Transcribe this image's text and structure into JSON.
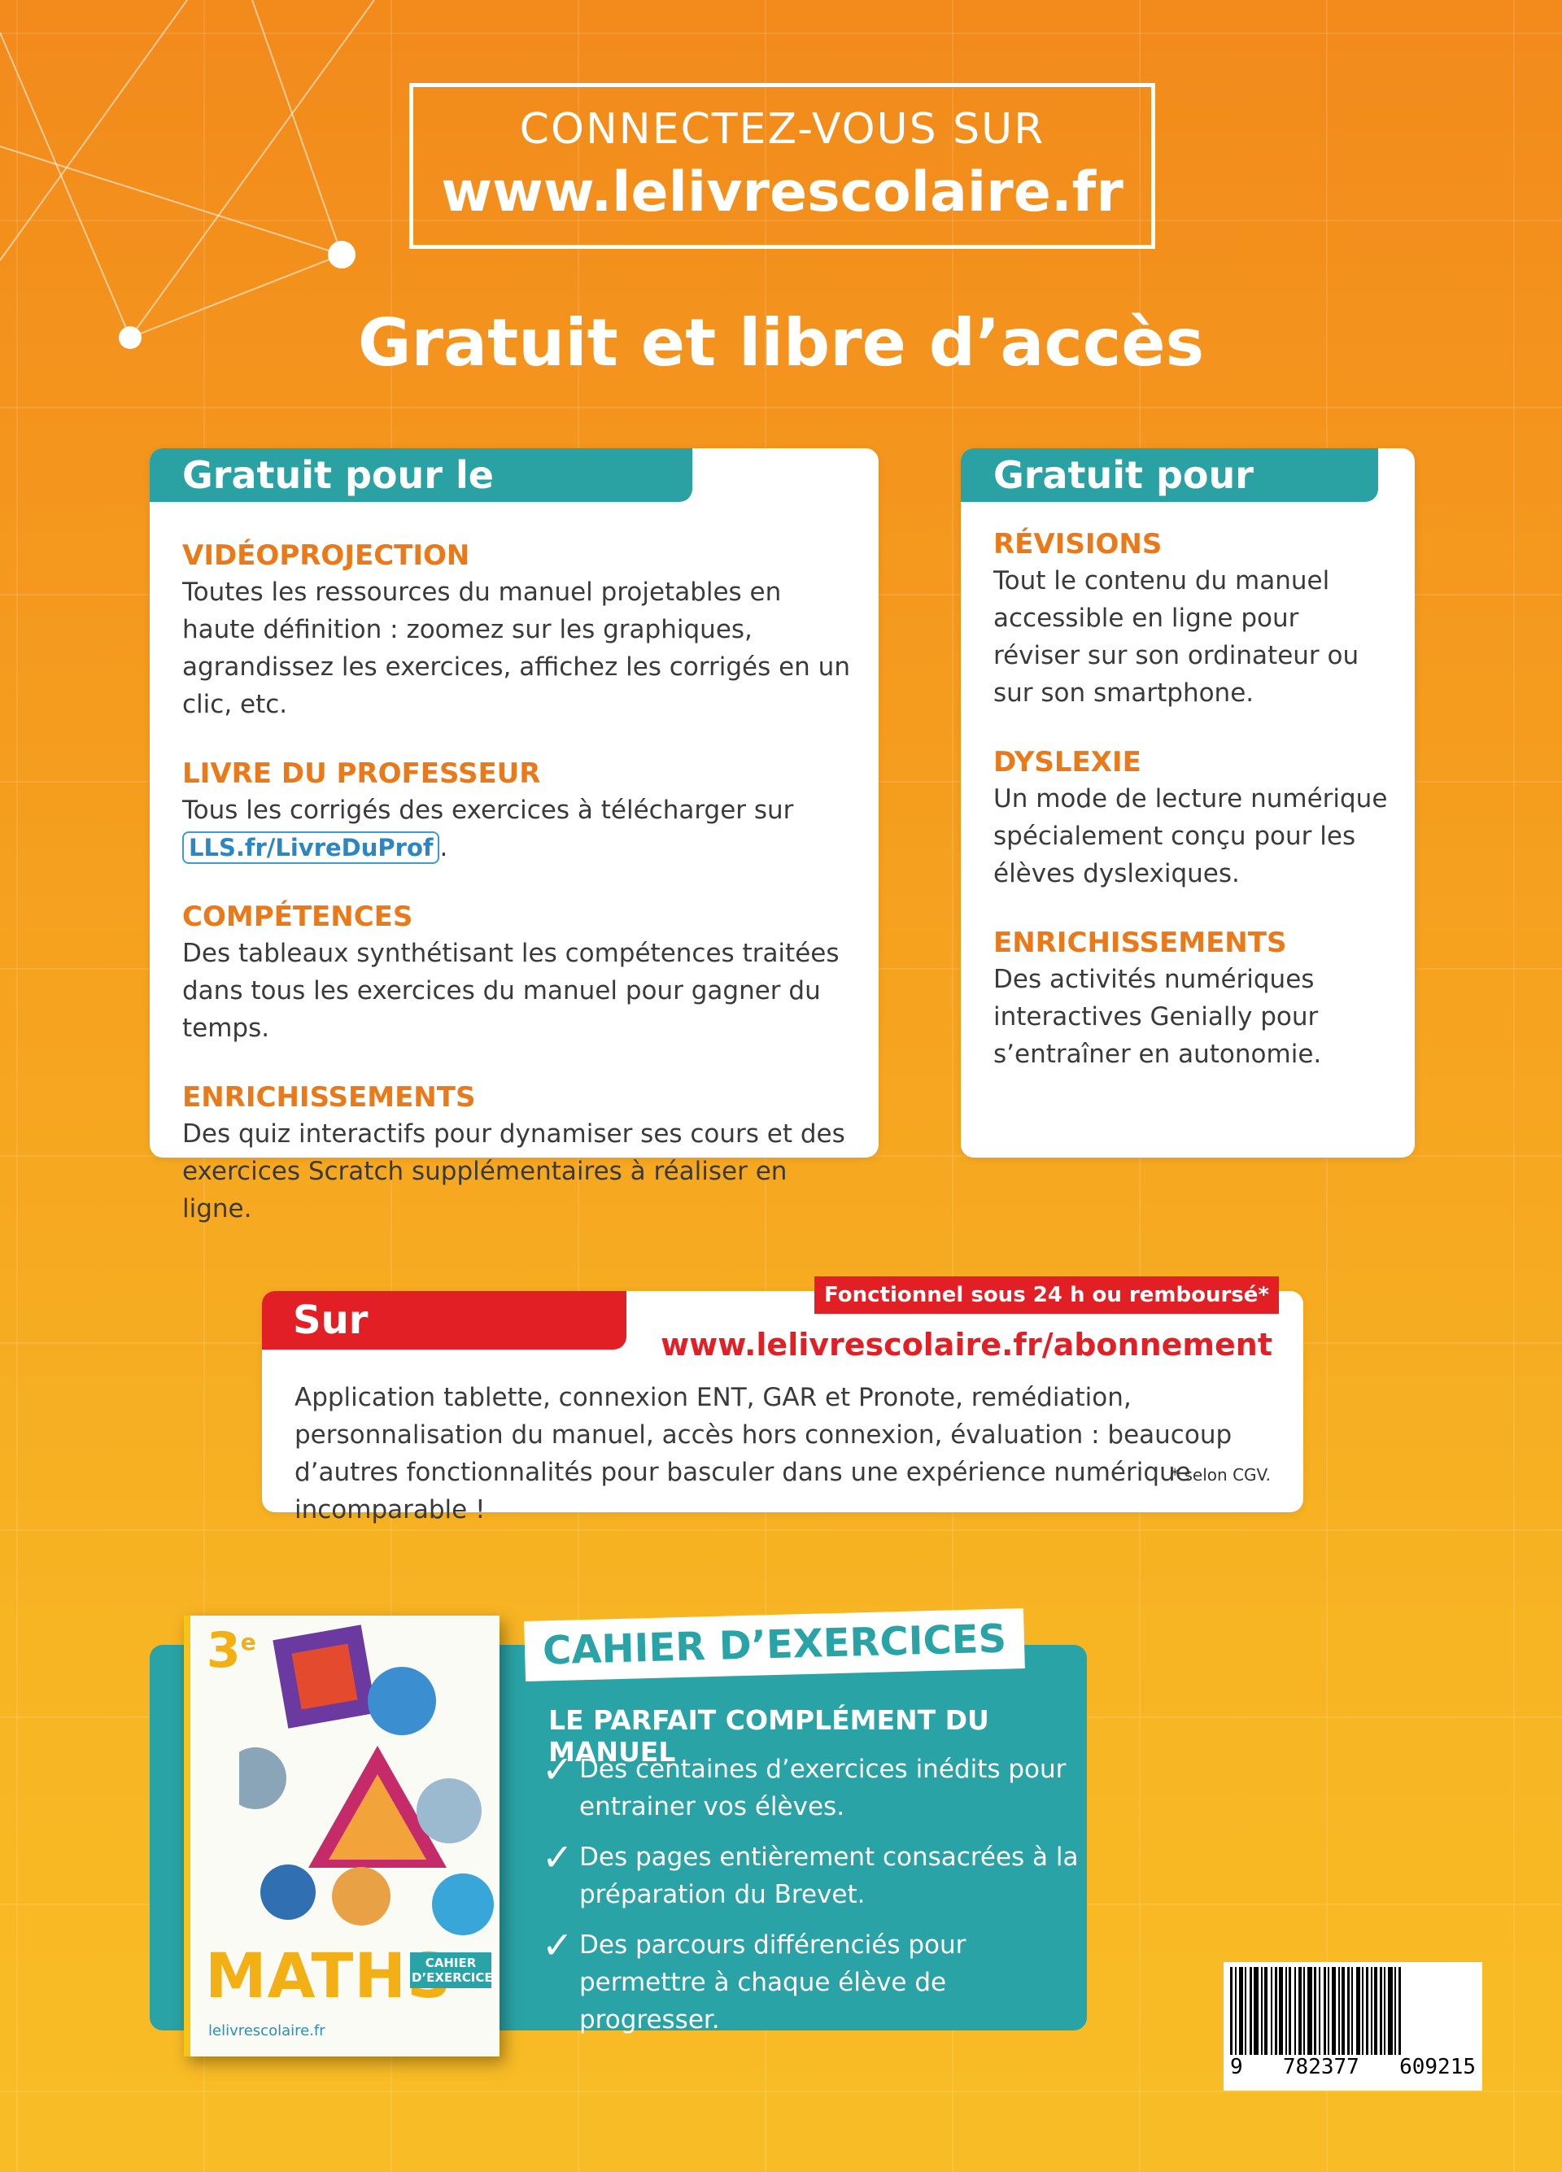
{
  "header": {
    "connect_line1": "CONNECTEZ-VOUS SUR",
    "connect_url": "www.lelivrescolaire.fr",
    "title": "Gratuit et libre d’accès"
  },
  "professor_card": {
    "tab": "Gratuit pour le professeur",
    "sections": [
      {
        "title": "VIDÉOPROJECTION",
        "text": "Toutes les ressources du manuel projetables en haute définition : zoomez sur les graphiques, agrandissez les exercices, affichez les corrigés en un clic, etc."
      },
      {
        "title": "LIVRE DU PROFESSEUR",
        "text": "Tous les corrigés des exercices à télécharger sur",
        "link": "LLS.fr/LivreDuProf",
        "after": "."
      },
      {
        "title": "COMPÉTENCES",
        "text": "Des tableaux synthétisant les compétences traitées dans tous les exercices du manuel pour gagner du temps."
      },
      {
        "title": "ENRICHISSEMENTS",
        "text": "Des quiz interactifs pour dynamiser ses cours et des exercices Scratch supplémentaires à réaliser en ligne."
      }
    ]
  },
  "student_card": {
    "tab": "Gratuit pour l’élève",
    "sections": [
      {
        "title": "RÉVISIONS",
        "text": "Tout le contenu du manuel accessible en ligne pour réviser sur son ordinateur ou sur son smartphone."
      },
      {
        "title": "DYSLEXIE",
        "text": "Un mode de lecture numérique spécialement conçu pour les élèves dyslexiques."
      },
      {
        "title": "ENRICHISSEMENTS",
        "text": "Des activités numériques interactives Genially pour s’entraîner en autonomie."
      }
    ]
  },
  "subscription": {
    "tab": "Sur abonnement",
    "badge": "Fonctionnel sous 24 h ou remboursé*",
    "url": "www.lelivrescolaire.fr/abonnement",
    "text": "Application tablette, connexion ENT, GAR et Pronote, remédiation, personnalisation du manuel, accès hors connexion, évaluation : beaucoup d’autres fonctionnalités pour basculer dans une expérience numérique incomparable !",
    "note": "* selon CGV."
  },
  "cahier": {
    "tab": "CAHIER D’EXERCICES",
    "subtitle": "LE PARFAIT COMPLÉMENT DU MANUEL",
    "check_glyph": "✓",
    "items": [
      "Des centaines d’exercices inédits pour entrainer vos élèves.",
      "Des pages entièrement consacrées à la préparation du Brevet.",
      "Des parcours différenciés pour permettre à chaque élève de progresser."
    ]
  },
  "book_cover": {
    "grade": "3",
    "grade_sup": "e",
    "title": "MATHS",
    "label": "CAHIER D’EXERCICES",
    "brand": "lelivrescolaire.fr"
  },
  "barcode": {
    "digits": [
      "9",
      "782377",
      "609215"
    ]
  },
  "colors": {
    "orange_top": "#f28a1c",
    "orange_bottom": "#f8bd26",
    "teal": "#2aa2a4",
    "red": "#e31f26",
    "section_title": "#ea7a19"
  }
}
